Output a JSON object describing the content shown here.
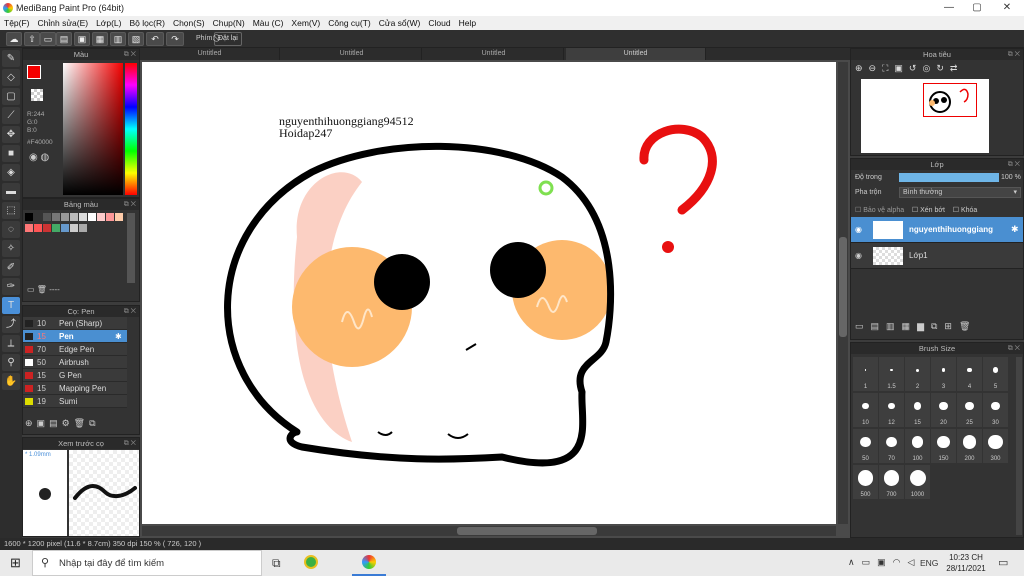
{
  "window": {
    "title": "MediBang Paint Pro (64bit)",
    "minimize": "—",
    "maximize": "▢",
    "close": "✕"
  },
  "menu": [
    "Tệp(F)",
    "Chỉnh sửa(E)",
    "Lớp(L)",
    "Bộ lọc(R)",
    "Chọn(S)",
    "Chụp(N)",
    "Màu (C)",
    "Xem(V)",
    "Công cụ(T)",
    "Cửa sổ(W)",
    "Cloud",
    "Help"
  ],
  "toolbar": {
    "shortcut_label": "Phím",
    "reset_label": "Đặt lại"
  },
  "color_panel": {
    "title": "Màu",
    "r": "R:244",
    "g": "G:0",
    "b": "B:0",
    "hex": "#F40000",
    "primary_color": "#f40000"
  },
  "palette_panel": {
    "title": "Bảng màu",
    "swatches": [
      "#000000",
      "#333333",
      "#555555",
      "#777777",
      "#999999",
      "#bbbbbb",
      "#dddddd",
      "#ffffff",
      "#ffcccc",
      "#ff9999",
      "#ffccaa",
      "#ff7777",
      "#ff5555",
      "#cc3333",
      "#44aa66",
      "#6699cc",
      "#cccccc",
      "#aaaaaa"
    ],
    "footer": "----"
  },
  "brush_panel": {
    "title": "Cọ: Pen",
    "items": [
      {
        "size": "10",
        "name": "Pen (Sharp)",
        "color": "#222222",
        "active": false
      },
      {
        "size": "15",
        "name": "Pen",
        "color": "#222222",
        "active": true
      },
      {
        "size": "70",
        "name": "Edge Pen",
        "color": "#cc2222",
        "active": false
      },
      {
        "size": "50",
        "name": "Airbrush",
        "color": "#ffffff",
        "active": false
      },
      {
        "size": "15",
        "name": "G Pen",
        "color": "#cc2222",
        "active": false
      },
      {
        "size": "15",
        "name": "Mapping Pen",
        "color": "#cc2222",
        "active": false
      },
      {
        "size": "19",
        "name": "Sumi",
        "color": "#dddd00",
        "active": false
      }
    ]
  },
  "preview_panel": {
    "title": "Xem trước cọ",
    "size": "1.09mm"
  },
  "tabs": [
    "Untitled",
    "Untitled",
    "Untitled",
    "Untitled"
  ],
  "canvas": {
    "text_line1": "nguyenthihuonggiang94512",
    "text_line2": "Hoidap247"
  },
  "navigator_panel": {
    "title": "Hoa tiêu"
  },
  "layer_panel": {
    "title": "Lớp",
    "opacity_label": "Độ trong",
    "opacity_value": "100 %",
    "opacity": 1.0,
    "blend_label": "Pha trộn",
    "blend_value": "Bình thường",
    "protect_alpha": "Bảo vệ alpha",
    "clip": "Xén bớt",
    "lock": "Khóa",
    "layers": [
      {
        "name": "nguyenthihuonggiang",
        "active": true
      },
      {
        "name": "Lớp1",
        "active": false
      }
    ]
  },
  "brush_size_panel": {
    "title": "Brush Size",
    "sizes": [
      "1",
      "1.5",
      "2",
      "3",
      "4",
      "5",
      "10",
      "12",
      "15",
      "20",
      "25",
      "30",
      "50",
      "70",
      "100",
      "150",
      "200",
      "300",
      "500",
      "700",
      "1000"
    ]
  },
  "statusbar": {
    "text": "1600 * 1200 pixel   (11.6 * 8.7cm)   350 dpi   150 %   ( 726, 120 )"
  },
  "taskbar": {
    "search_placeholder": "Nhập tại đây để tìm kiếm",
    "language": "ENG",
    "time": "10:23 CH",
    "date": "28/11/2021"
  }
}
